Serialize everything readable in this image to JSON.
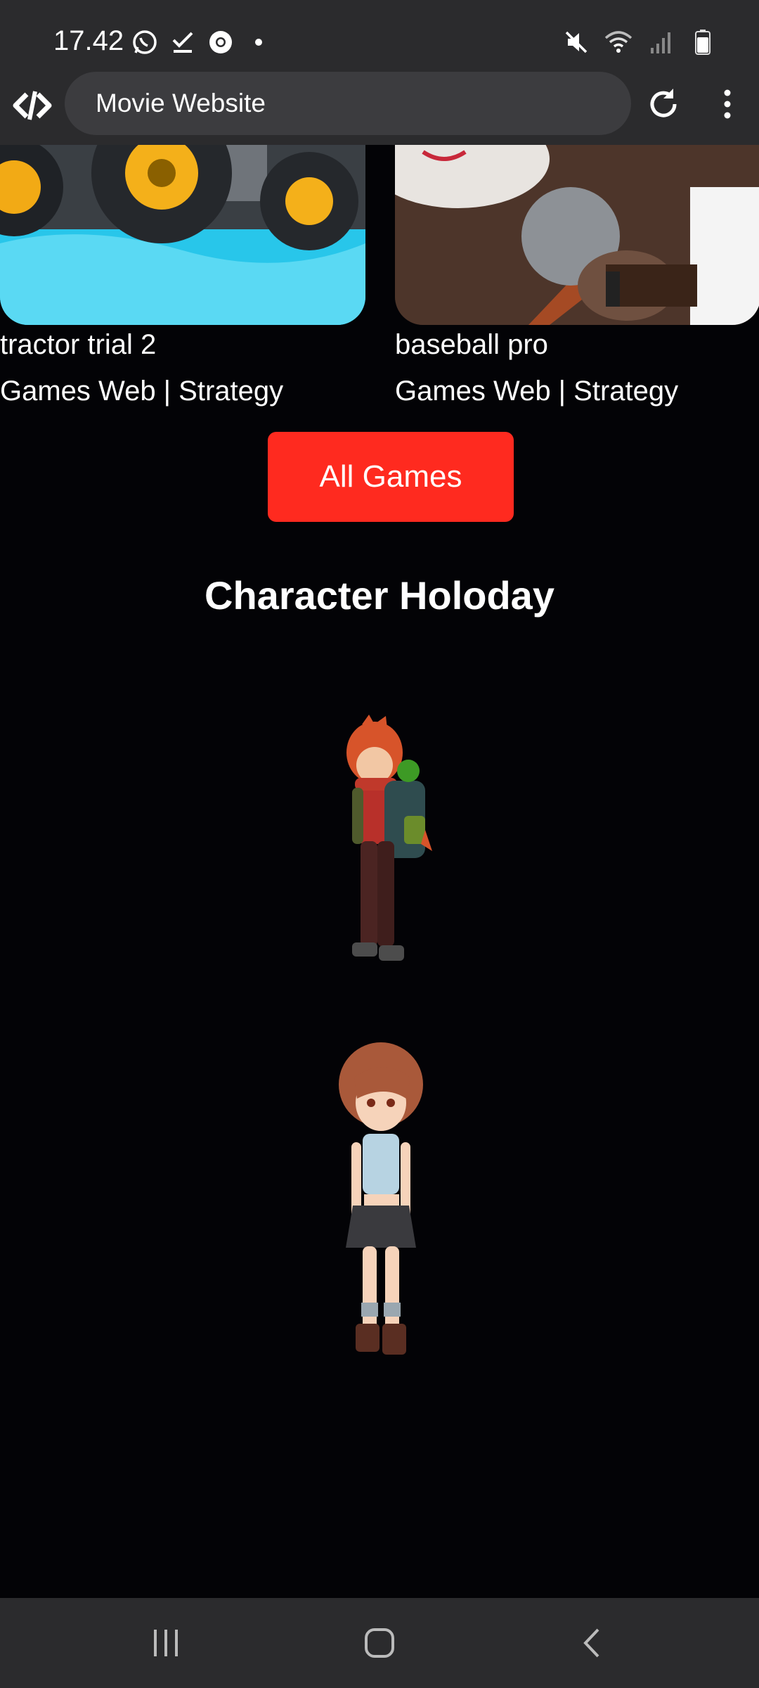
{
  "status_bar": {
    "time": "17.42",
    "left_icons": [
      "whatsapp-icon",
      "check-icon",
      "chrome-icon",
      "dot-icon"
    ],
    "right_icons": [
      "mute-icon",
      "wifi-icon",
      "signal-icon",
      "battery-icon"
    ]
  },
  "browser": {
    "url_title": "Movie Website"
  },
  "games": [
    {
      "title": "tractor trial 2",
      "meta": "Games Web | Strategy"
    },
    {
      "title": "baseball pro",
      "meta": "Games Web | Strategy"
    }
  ],
  "all_games_label": "All Games",
  "section": {
    "title": "Character Holoday"
  },
  "colors": {
    "accent": "#ff2a1f",
    "background": "#030306",
    "chrome_bar": "#2b2b2d"
  }
}
